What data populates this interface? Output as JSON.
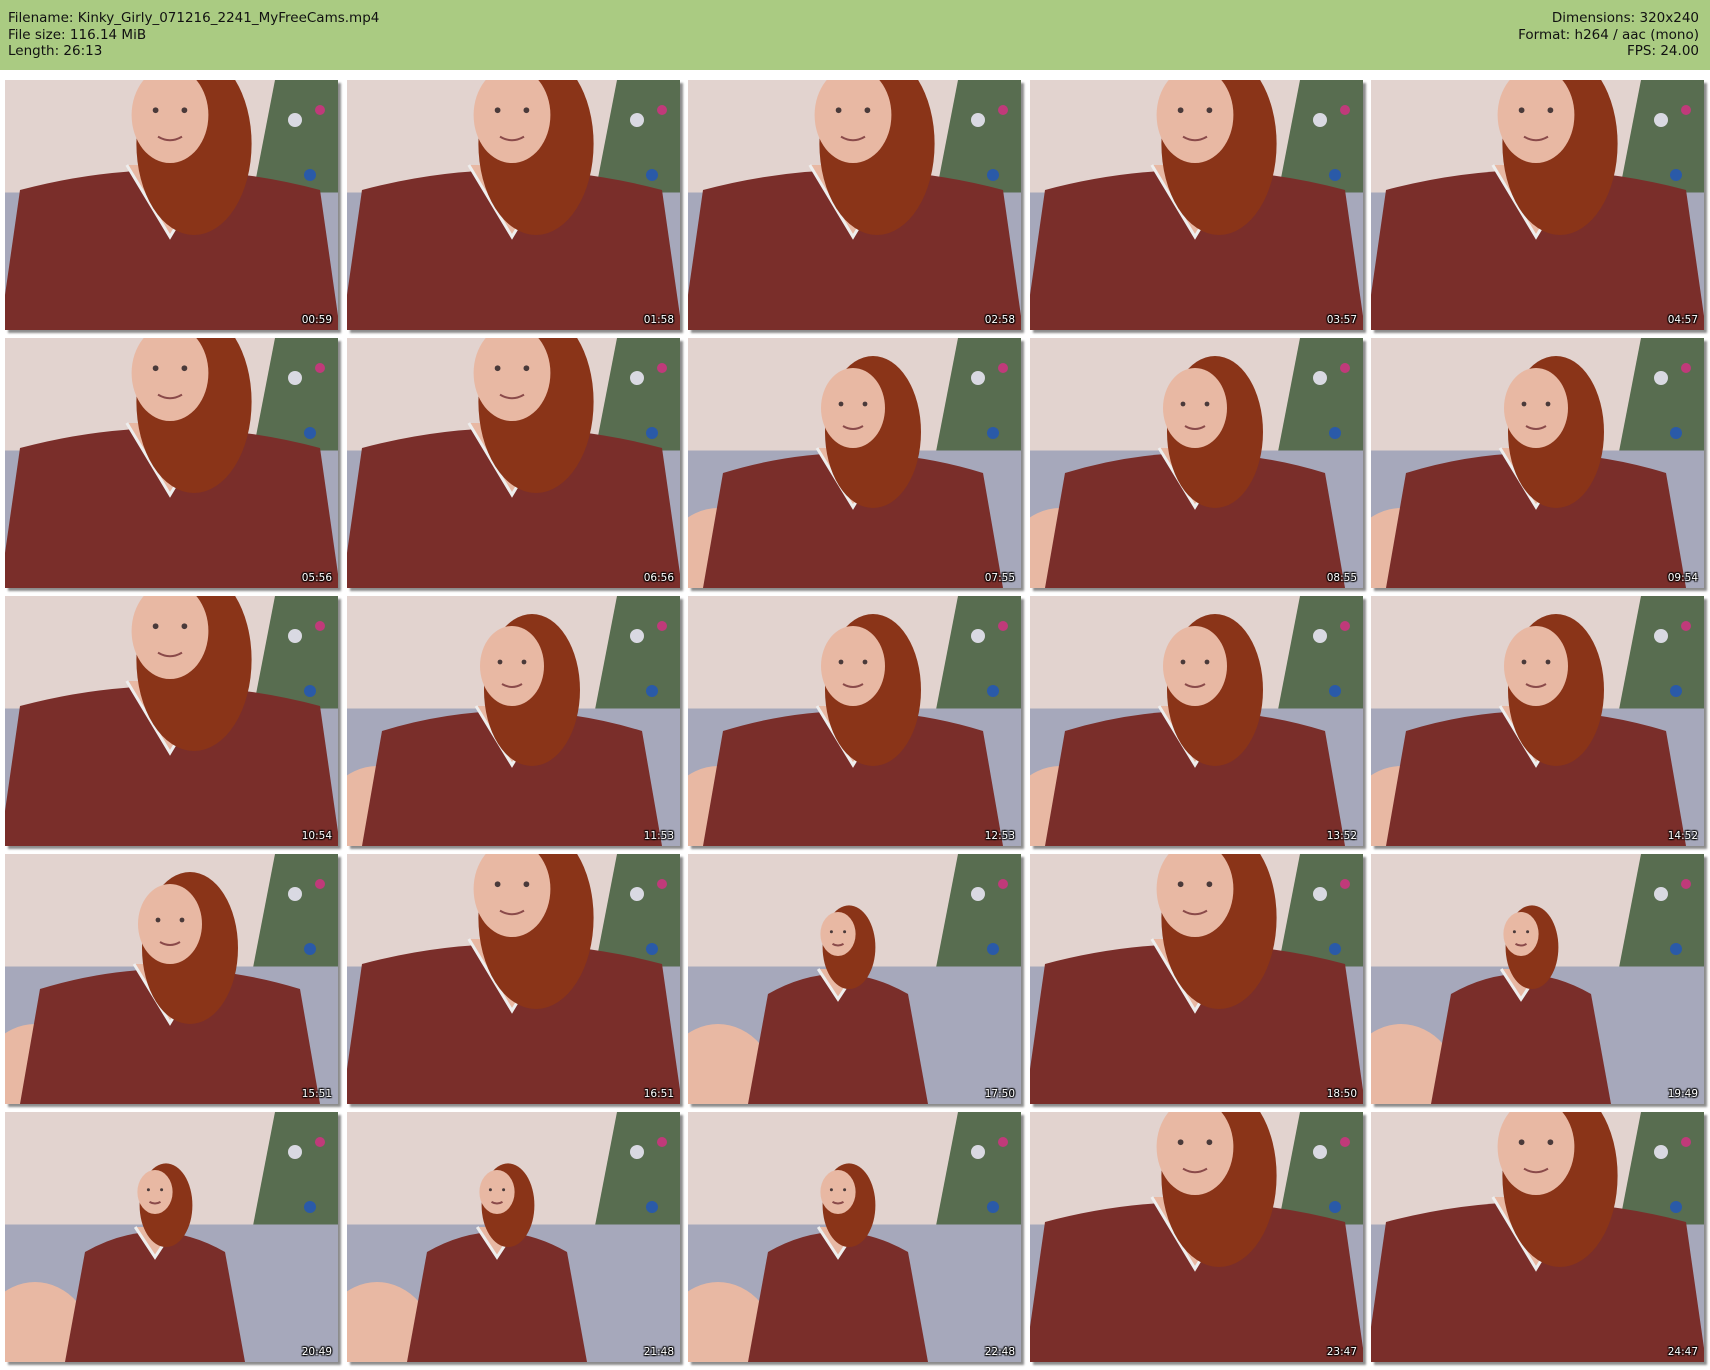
{
  "header": {
    "filename_line": "Filename: Kinky_Girly_071216_2241_MyFreeCams.mp4",
    "filesize_line": "File size: 116.14 MiB",
    "length_line": "Length: 26:13",
    "dimensions_line": "Dimensions: 320x240",
    "format_line": "Format: h264 / aac (mono)",
    "fps_line": "FPS: 24.00"
  },
  "colors": {
    "header_bg": "#aacb82",
    "wall": "#e2d3cf",
    "sofa": "#a6a8bb",
    "hoodie": "#7a2e2a",
    "hair": "#8a3418",
    "skin": "#e8b8a3"
  },
  "thumbnails": [
    {
      "time": "00:59",
      "scene": "close"
    },
    {
      "time": "01:58",
      "scene": "close"
    },
    {
      "time": "02:58",
      "scene": "close"
    },
    {
      "time": "03:57",
      "scene": "close"
    },
    {
      "time": "04:57",
      "scene": "close"
    },
    {
      "time": "05:56",
      "scene": "close"
    },
    {
      "time": "06:56",
      "scene": "close"
    },
    {
      "time": "07:55",
      "scene": "mid"
    },
    {
      "time": "08:55",
      "scene": "mid"
    },
    {
      "time": "09:54",
      "scene": "mid"
    },
    {
      "time": "10:54",
      "scene": "close"
    },
    {
      "time": "11:53",
      "scene": "mid"
    },
    {
      "time": "12:53",
      "scene": "mid"
    },
    {
      "time": "13:52",
      "scene": "mid"
    },
    {
      "time": "14:52",
      "scene": "mid"
    },
    {
      "time": "15:51",
      "scene": "mid"
    },
    {
      "time": "16:51",
      "scene": "close"
    },
    {
      "time": "17:50",
      "scene": "far"
    },
    {
      "time": "18:50",
      "scene": "close"
    },
    {
      "time": "19:49",
      "scene": "far"
    },
    {
      "time": "20:49",
      "scene": "far"
    },
    {
      "time": "21:48",
      "scene": "far"
    },
    {
      "time": "22:48",
      "scene": "far"
    },
    {
      "time": "23:47",
      "scene": "close"
    },
    {
      "time": "24:47",
      "scene": "close"
    }
  ]
}
